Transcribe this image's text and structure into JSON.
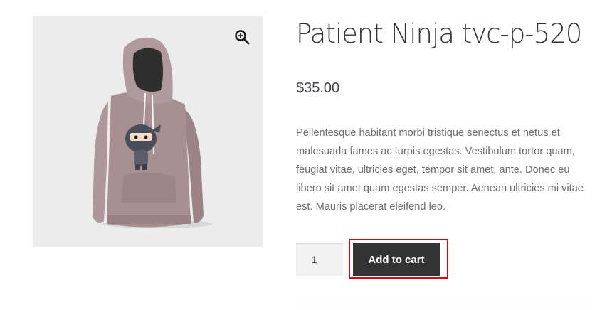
{
  "product": {
    "title": "Patient Ninja tvc-p-520",
    "price": "$35.00",
    "description": "Pellentesque habitant morbi tristique senectus et netus et malesuada fames ac turpis egestas. Vestibulum tortor quam, feugiat vitae, ultricies eget, tempor sit amet, ante. Donec eu libero sit amet quam egestas semper. Aenean ultricies mi vitae est. Mauris placerat eleifend leo.",
    "quantity": "1",
    "add_to_cart_label": "Add to cart"
  },
  "icons": {
    "zoom": "magnifier-plus-icon"
  },
  "colors": {
    "button_bg": "#333333",
    "button_text": "#ffffff",
    "highlight_border": "#e3000f",
    "hoodie": "#a88f92",
    "image_bg": "#ececec"
  }
}
